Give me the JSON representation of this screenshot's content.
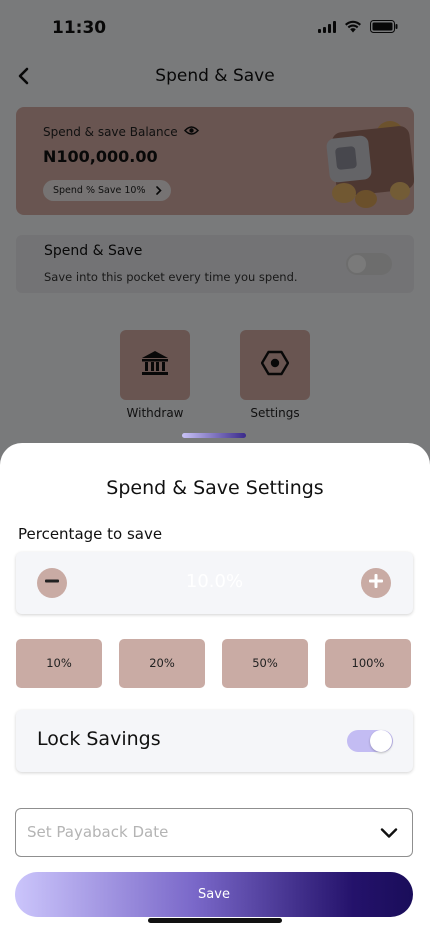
{
  "status_bar": {
    "time": "11:30"
  },
  "header": {
    "title": "Spend & Save"
  },
  "balance_card": {
    "label": "Spend & save Balance",
    "amount": "N100,000.00",
    "chip_label": "Spend % Save 10%"
  },
  "auto_save": {
    "title": "Spend & Save",
    "subtitle": "Save into this pocket every time you spend.",
    "enabled": false
  },
  "actions": [
    {
      "label": "Withdraw",
      "icon": "bank-icon"
    },
    {
      "label": "Settings",
      "icon": "hexagon-settings-icon"
    }
  ],
  "sheet": {
    "title": "Spend & Save Settings",
    "percentage_label": "Percentage to save",
    "percentage_value": "10.0%",
    "presets": [
      "10%",
      "20%",
      "50%",
      "100%"
    ],
    "lock_label": "Lock Savings",
    "lock_enabled": true,
    "date_placeholder": "Set Payaback Date",
    "save_label": "Save"
  },
  "colors": {
    "accent_rose": "#c9aba4",
    "toggle_on": "#c3bcf3",
    "button_gradient_start": "#cbc5fb",
    "button_gradient_end": "#1a0d5a"
  }
}
